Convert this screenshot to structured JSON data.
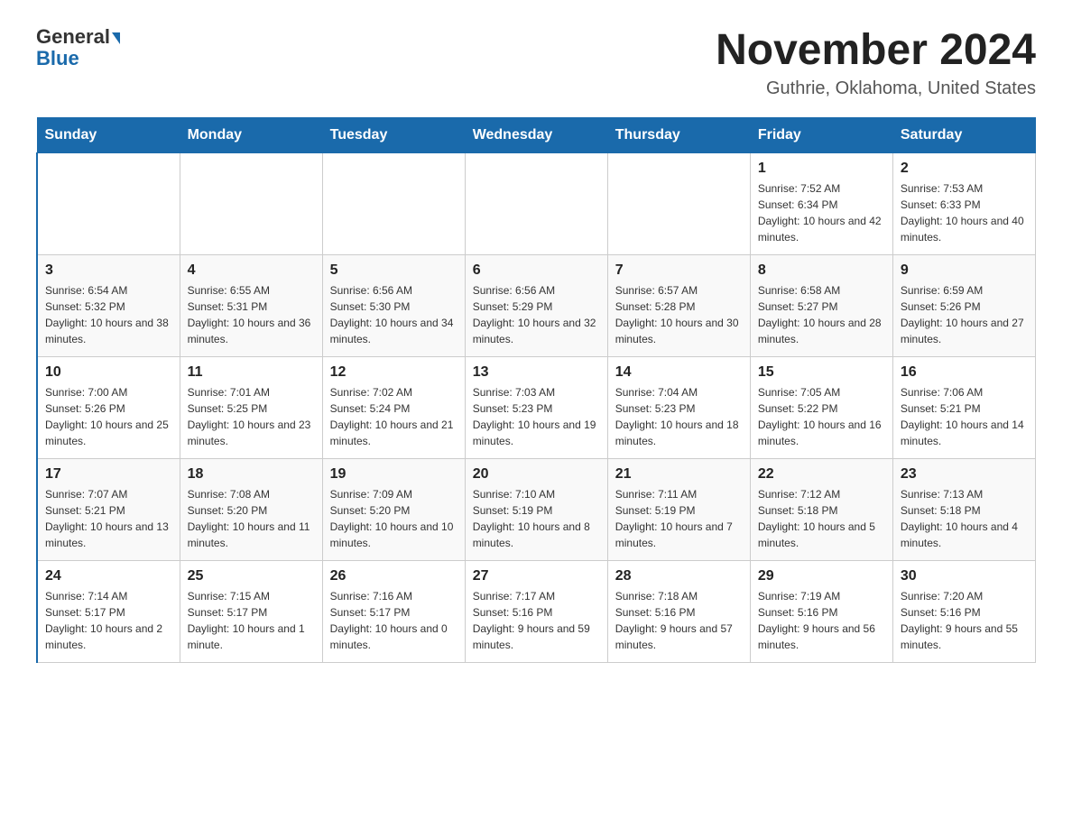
{
  "logo": {
    "general": "General",
    "triangle": "▶",
    "blue": "Blue"
  },
  "title": "November 2024",
  "subtitle": "Guthrie, Oklahoma, United States",
  "days_header": [
    "Sunday",
    "Monday",
    "Tuesday",
    "Wednesday",
    "Thursday",
    "Friday",
    "Saturday"
  ],
  "weeks": [
    [
      {
        "num": "",
        "info": ""
      },
      {
        "num": "",
        "info": ""
      },
      {
        "num": "",
        "info": ""
      },
      {
        "num": "",
        "info": ""
      },
      {
        "num": "",
        "info": ""
      },
      {
        "num": "1",
        "info": "Sunrise: 7:52 AM\nSunset: 6:34 PM\nDaylight: 10 hours and 42 minutes."
      },
      {
        "num": "2",
        "info": "Sunrise: 7:53 AM\nSunset: 6:33 PM\nDaylight: 10 hours and 40 minutes."
      }
    ],
    [
      {
        "num": "3",
        "info": "Sunrise: 6:54 AM\nSunset: 5:32 PM\nDaylight: 10 hours and 38 minutes."
      },
      {
        "num": "4",
        "info": "Sunrise: 6:55 AM\nSunset: 5:31 PM\nDaylight: 10 hours and 36 minutes."
      },
      {
        "num": "5",
        "info": "Sunrise: 6:56 AM\nSunset: 5:30 PM\nDaylight: 10 hours and 34 minutes."
      },
      {
        "num": "6",
        "info": "Sunrise: 6:56 AM\nSunset: 5:29 PM\nDaylight: 10 hours and 32 minutes."
      },
      {
        "num": "7",
        "info": "Sunrise: 6:57 AM\nSunset: 5:28 PM\nDaylight: 10 hours and 30 minutes."
      },
      {
        "num": "8",
        "info": "Sunrise: 6:58 AM\nSunset: 5:27 PM\nDaylight: 10 hours and 28 minutes."
      },
      {
        "num": "9",
        "info": "Sunrise: 6:59 AM\nSunset: 5:26 PM\nDaylight: 10 hours and 27 minutes."
      }
    ],
    [
      {
        "num": "10",
        "info": "Sunrise: 7:00 AM\nSunset: 5:26 PM\nDaylight: 10 hours and 25 minutes."
      },
      {
        "num": "11",
        "info": "Sunrise: 7:01 AM\nSunset: 5:25 PM\nDaylight: 10 hours and 23 minutes."
      },
      {
        "num": "12",
        "info": "Sunrise: 7:02 AM\nSunset: 5:24 PM\nDaylight: 10 hours and 21 minutes."
      },
      {
        "num": "13",
        "info": "Sunrise: 7:03 AM\nSunset: 5:23 PM\nDaylight: 10 hours and 19 minutes."
      },
      {
        "num": "14",
        "info": "Sunrise: 7:04 AM\nSunset: 5:23 PM\nDaylight: 10 hours and 18 minutes."
      },
      {
        "num": "15",
        "info": "Sunrise: 7:05 AM\nSunset: 5:22 PM\nDaylight: 10 hours and 16 minutes."
      },
      {
        "num": "16",
        "info": "Sunrise: 7:06 AM\nSunset: 5:21 PM\nDaylight: 10 hours and 14 minutes."
      }
    ],
    [
      {
        "num": "17",
        "info": "Sunrise: 7:07 AM\nSunset: 5:21 PM\nDaylight: 10 hours and 13 minutes."
      },
      {
        "num": "18",
        "info": "Sunrise: 7:08 AM\nSunset: 5:20 PM\nDaylight: 10 hours and 11 minutes."
      },
      {
        "num": "19",
        "info": "Sunrise: 7:09 AM\nSunset: 5:20 PM\nDaylight: 10 hours and 10 minutes."
      },
      {
        "num": "20",
        "info": "Sunrise: 7:10 AM\nSunset: 5:19 PM\nDaylight: 10 hours and 8 minutes."
      },
      {
        "num": "21",
        "info": "Sunrise: 7:11 AM\nSunset: 5:19 PM\nDaylight: 10 hours and 7 minutes."
      },
      {
        "num": "22",
        "info": "Sunrise: 7:12 AM\nSunset: 5:18 PM\nDaylight: 10 hours and 5 minutes."
      },
      {
        "num": "23",
        "info": "Sunrise: 7:13 AM\nSunset: 5:18 PM\nDaylight: 10 hours and 4 minutes."
      }
    ],
    [
      {
        "num": "24",
        "info": "Sunrise: 7:14 AM\nSunset: 5:17 PM\nDaylight: 10 hours and 2 minutes."
      },
      {
        "num": "25",
        "info": "Sunrise: 7:15 AM\nSunset: 5:17 PM\nDaylight: 10 hours and 1 minute."
      },
      {
        "num": "26",
        "info": "Sunrise: 7:16 AM\nSunset: 5:17 PM\nDaylight: 10 hours and 0 minutes."
      },
      {
        "num": "27",
        "info": "Sunrise: 7:17 AM\nSunset: 5:16 PM\nDaylight: 9 hours and 59 minutes."
      },
      {
        "num": "28",
        "info": "Sunrise: 7:18 AM\nSunset: 5:16 PM\nDaylight: 9 hours and 57 minutes."
      },
      {
        "num": "29",
        "info": "Sunrise: 7:19 AM\nSunset: 5:16 PM\nDaylight: 9 hours and 56 minutes."
      },
      {
        "num": "30",
        "info": "Sunrise: 7:20 AM\nSunset: 5:16 PM\nDaylight: 9 hours and 55 minutes."
      }
    ]
  ]
}
